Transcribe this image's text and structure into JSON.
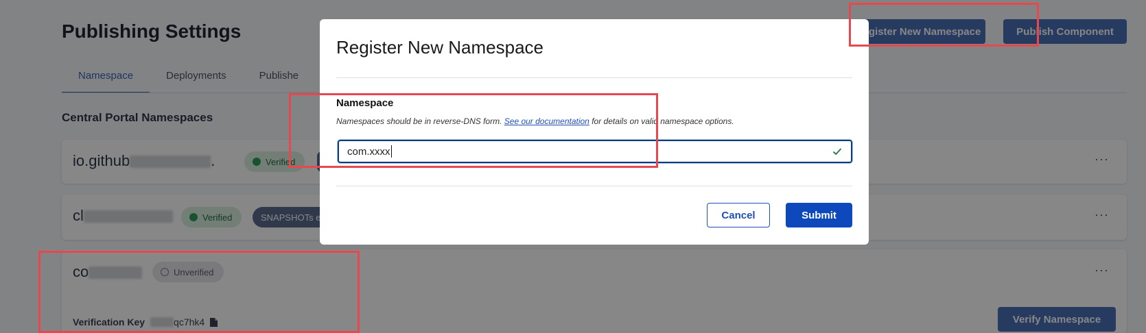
{
  "page": {
    "title": "Publishing Settings",
    "header_buttons": {
      "register": "Register New Namespace",
      "publish": "Publish Component"
    },
    "tabs": [
      {
        "label": "Namespace",
        "active": true
      },
      {
        "label": "Deployments",
        "active": false
      },
      {
        "label": "Publishe",
        "active": false
      }
    ],
    "section_title": "Central Portal Namespaces",
    "namespaces": [
      {
        "name_prefix": "io.github",
        "name_suffix": ".",
        "status": "Verified",
        "extra_badge": ""
      },
      {
        "name_prefix": "cl",
        "name_suffix": "",
        "status": "Verified",
        "extra_badge": "SNAPSHOTs en"
      },
      {
        "name_prefix": "co",
        "name_suffix": "",
        "status": "Unverified",
        "verification_label": "Verification Key",
        "verification_value": "qc7hk4",
        "verify_button": "Verify Namespace"
      }
    ],
    "kebab": "···"
  },
  "modal": {
    "title": "Register New Namespace",
    "field_label": "Namespace",
    "help_before": "Namespaces should be in reverse-DNS form. ",
    "help_link": "See our documentation",
    "help_after": " for details on valid namespace options.",
    "input_value": "com.xxxx",
    "cancel_label": "Cancel",
    "submit_label": "Submit"
  },
  "colors": {
    "accent": "#0d49bd",
    "annotation": "#e8474d",
    "verified_bg": "#d7efdf"
  },
  "icons": [
    "check-icon",
    "document-icon",
    "kebab-menu-icon",
    "status-dot-icon"
  ]
}
